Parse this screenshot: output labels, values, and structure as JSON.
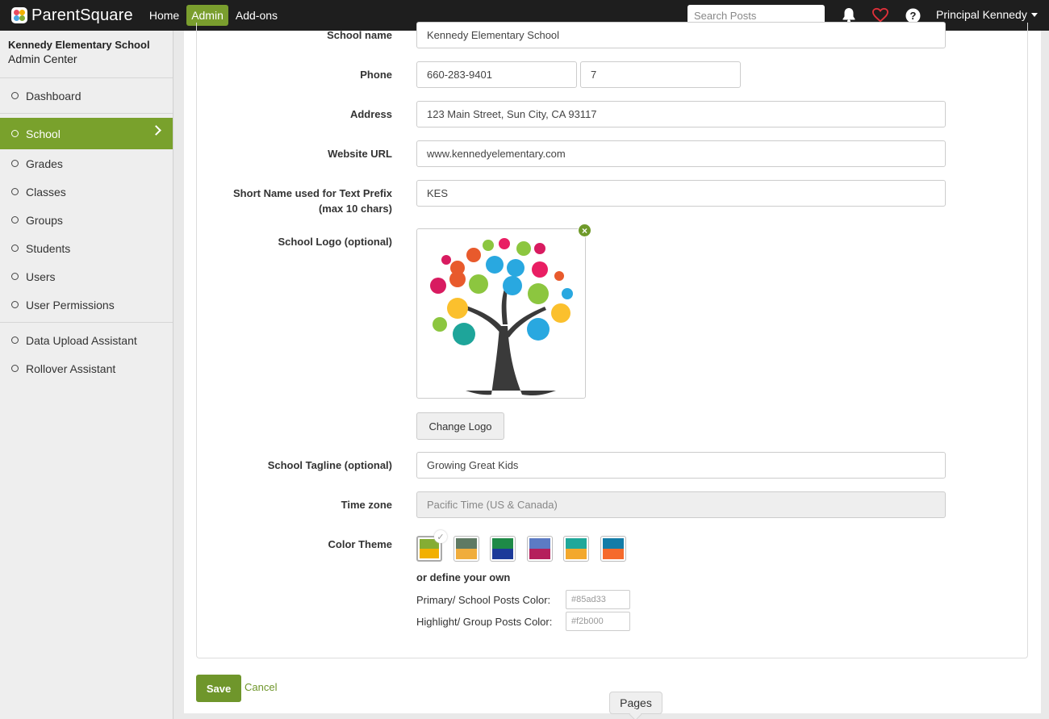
{
  "topbar": {
    "brand": "ParentSquare",
    "nav": [
      "Home",
      "Admin",
      "Add-ons"
    ],
    "active_nav": "Admin",
    "search_placeholder": "Search Posts",
    "user_name": "Principal Kennedy",
    "icons": [
      "bell-icon",
      "heart-icon",
      "help-icon"
    ]
  },
  "sidebar": {
    "school": "Kennedy Elementary School",
    "subtitle": "Admin Center",
    "items": [
      "Dashboard",
      "School",
      "Grades",
      "Classes",
      "Groups",
      "Students",
      "Users",
      "User Permissions",
      "Data Upload Assistant",
      "Rollover Assistant"
    ],
    "active": "School"
  },
  "form": {
    "school_name_label": "School name",
    "school_name": "Kennedy Elementary School",
    "phone_label": "Phone",
    "phone": "660-283-9401",
    "phone_ext": "7",
    "address_label": "Address",
    "address": "123 Main Street, Sun City, CA 93117",
    "website_label": "Website URL",
    "website": "www.kennedyelementary.com",
    "short_name_label_1": "Short Name used for Text Prefix",
    "short_name_label_2": "(max 10 chars)",
    "short_name": "KES",
    "logo_label": "School Logo (optional)",
    "change_logo": "Change Logo",
    "tagline_label": "School Tagline (optional)",
    "tagline": "Growing Great Kids",
    "timezone_label": "Time zone",
    "timezone": "Pacific Time (US & Canada)",
    "color_theme_label": "Color Theme",
    "themes": [
      {
        "top": "#85ad33",
        "bottom": "#f2b000",
        "selected": true
      },
      {
        "top": "#5f7a63",
        "bottom": "#f0ad3c",
        "selected": false
      },
      {
        "top": "#1e8a47",
        "bottom": "#1c3a99",
        "selected": false
      },
      {
        "top": "#5c7bc4",
        "bottom": "#b51f5c",
        "selected": false
      },
      {
        "top": "#1fa89a",
        "bottom": "#f3a82c",
        "selected": false
      },
      {
        "top": "#137ca8",
        "bottom": "#f56a2c",
        "selected": false
      }
    ],
    "define_own": "or define your own",
    "primary_label": "Primary/ School Posts Color:",
    "primary_value": "#85ad33",
    "highlight_label": "Highlight/ Group Posts Color:",
    "highlight_value": "#f2b000"
  },
  "actions": {
    "save": "Save",
    "cancel": "Cancel"
  },
  "pages_tab": "Pages"
}
